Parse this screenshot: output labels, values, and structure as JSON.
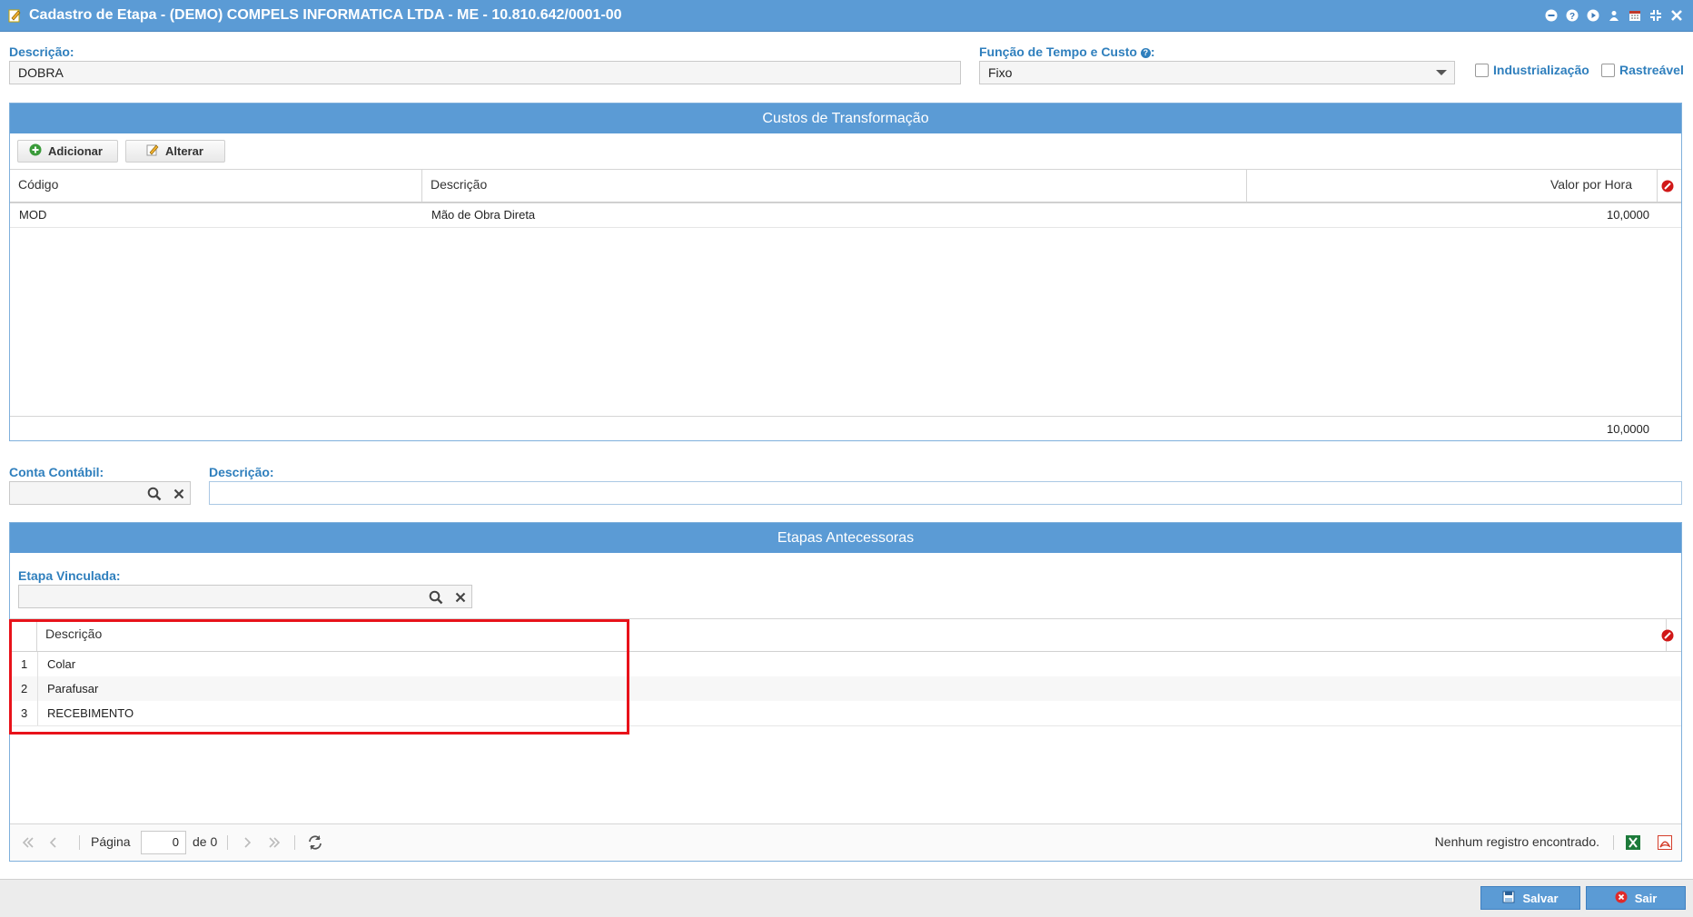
{
  "window": {
    "title": "Cadastro de Etapa - (DEMO) COMPELS INFORMATICA LTDA - ME - 10.810.642/0001-00"
  },
  "form": {
    "descricao_label": "Descrição:",
    "descricao_value": "DOBRA",
    "funcao_label": "Função de Tempo e Custo",
    "funcao_colon": ":",
    "funcao_value": "Fixo",
    "industrializacao_label": "Industrialização",
    "rastreavel_label": "Rastreável"
  },
  "custos": {
    "title": "Custos de Transformação",
    "add_label": "Adicionar",
    "edit_label": "Alterar",
    "columns": [
      "Código",
      "Descrição",
      "Valor por Hora"
    ],
    "rows": [
      {
        "codigo": "MOD",
        "descricao": "Mão de Obra Direta",
        "valor": "10,0000"
      }
    ],
    "total": "10,0000"
  },
  "conta": {
    "label": "Conta Contábil:",
    "value": "",
    "desc_label": "Descrição:",
    "desc_value": ""
  },
  "etapas": {
    "title": "Etapas Antecessoras",
    "vinculada_label": "Etapa Vinculada:",
    "vinculada_value": "",
    "column": "Descrição",
    "rows": [
      {
        "n": "1",
        "descricao": "Colar"
      },
      {
        "n": "2",
        "descricao": "Parafusar"
      },
      {
        "n": "3",
        "descricao": "RECEBIMENTO"
      }
    ],
    "pager": {
      "page_label": "Página",
      "page_value": "0",
      "of_label": "de 0",
      "status": "Nenhum registro encontrado."
    }
  },
  "footer": {
    "save_label": "Salvar",
    "exit_label": "Sair"
  },
  "colors": {
    "accent": "#5b9bd5",
    "label": "#2f7fbd",
    "highlight": "#e8121a"
  }
}
